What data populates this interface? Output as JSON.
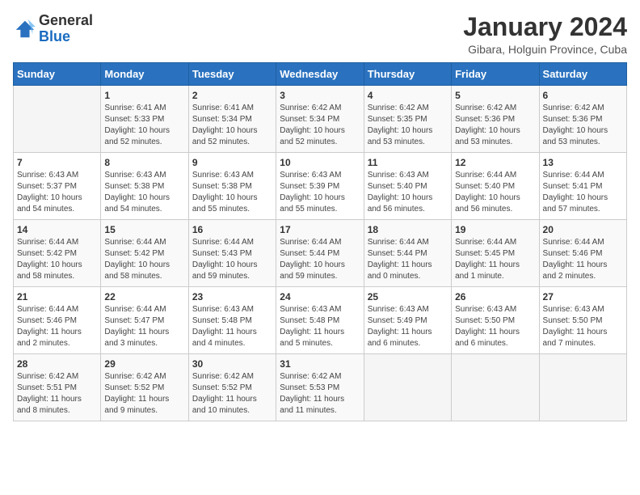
{
  "header": {
    "logo_line1": "General",
    "logo_line2": "Blue",
    "month_title": "January 2024",
    "subtitle": "Gibara, Holguin Province, Cuba"
  },
  "weekdays": [
    "Sunday",
    "Monday",
    "Tuesday",
    "Wednesday",
    "Thursday",
    "Friday",
    "Saturday"
  ],
  "weeks": [
    [
      {
        "day": "",
        "info": ""
      },
      {
        "day": "1",
        "info": "Sunrise: 6:41 AM\nSunset: 5:33 PM\nDaylight: 10 hours\nand 52 minutes."
      },
      {
        "day": "2",
        "info": "Sunrise: 6:41 AM\nSunset: 5:34 PM\nDaylight: 10 hours\nand 52 minutes."
      },
      {
        "day": "3",
        "info": "Sunrise: 6:42 AM\nSunset: 5:34 PM\nDaylight: 10 hours\nand 52 minutes."
      },
      {
        "day": "4",
        "info": "Sunrise: 6:42 AM\nSunset: 5:35 PM\nDaylight: 10 hours\nand 53 minutes."
      },
      {
        "day": "5",
        "info": "Sunrise: 6:42 AM\nSunset: 5:36 PM\nDaylight: 10 hours\nand 53 minutes."
      },
      {
        "day": "6",
        "info": "Sunrise: 6:42 AM\nSunset: 5:36 PM\nDaylight: 10 hours\nand 53 minutes."
      }
    ],
    [
      {
        "day": "7",
        "info": "Sunrise: 6:43 AM\nSunset: 5:37 PM\nDaylight: 10 hours\nand 54 minutes."
      },
      {
        "day": "8",
        "info": "Sunrise: 6:43 AM\nSunset: 5:38 PM\nDaylight: 10 hours\nand 54 minutes."
      },
      {
        "day": "9",
        "info": "Sunrise: 6:43 AM\nSunset: 5:38 PM\nDaylight: 10 hours\nand 55 minutes."
      },
      {
        "day": "10",
        "info": "Sunrise: 6:43 AM\nSunset: 5:39 PM\nDaylight: 10 hours\nand 55 minutes."
      },
      {
        "day": "11",
        "info": "Sunrise: 6:43 AM\nSunset: 5:40 PM\nDaylight: 10 hours\nand 56 minutes."
      },
      {
        "day": "12",
        "info": "Sunrise: 6:44 AM\nSunset: 5:40 PM\nDaylight: 10 hours\nand 56 minutes."
      },
      {
        "day": "13",
        "info": "Sunrise: 6:44 AM\nSunset: 5:41 PM\nDaylight: 10 hours\nand 57 minutes."
      }
    ],
    [
      {
        "day": "14",
        "info": "Sunrise: 6:44 AM\nSunset: 5:42 PM\nDaylight: 10 hours\nand 58 minutes."
      },
      {
        "day": "15",
        "info": "Sunrise: 6:44 AM\nSunset: 5:42 PM\nDaylight: 10 hours\nand 58 minutes."
      },
      {
        "day": "16",
        "info": "Sunrise: 6:44 AM\nSunset: 5:43 PM\nDaylight: 10 hours\nand 59 minutes."
      },
      {
        "day": "17",
        "info": "Sunrise: 6:44 AM\nSunset: 5:44 PM\nDaylight: 10 hours\nand 59 minutes."
      },
      {
        "day": "18",
        "info": "Sunrise: 6:44 AM\nSunset: 5:44 PM\nDaylight: 11 hours\nand 0 minutes."
      },
      {
        "day": "19",
        "info": "Sunrise: 6:44 AM\nSunset: 5:45 PM\nDaylight: 11 hours\nand 1 minute."
      },
      {
        "day": "20",
        "info": "Sunrise: 6:44 AM\nSunset: 5:46 PM\nDaylight: 11 hours\nand 2 minutes."
      }
    ],
    [
      {
        "day": "21",
        "info": "Sunrise: 6:44 AM\nSunset: 5:46 PM\nDaylight: 11 hours\nand 2 minutes."
      },
      {
        "day": "22",
        "info": "Sunrise: 6:44 AM\nSunset: 5:47 PM\nDaylight: 11 hours\nand 3 minutes."
      },
      {
        "day": "23",
        "info": "Sunrise: 6:43 AM\nSunset: 5:48 PM\nDaylight: 11 hours\nand 4 minutes."
      },
      {
        "day": "24",
        "info": "Sunrise: 6:43 AM\nSunset: 5:48 PM\nDaylight: 11 hours\nand 5 minutes."
      },
      {
        "day": "25",
        "info": "Sunrise: 6:43 AM\nSunset: 5:49 PM\nDaylight: 11 hours\nand 6 minutes."
      },
      {
        "day": "26",
        "info": "Sunrise: 6:43 AM\nSunset: 5:50 PM\nDaylight: 11 hours\nand 6 minutes."
      },
      {
        "day": "27",
        "info": "Sunrise: 6:43 AM\nSunset: 5:50 PM\nDaylight: 11 hours\nand 7 minutes."
      }
    ],
    [
      {
        "day": "28",
        "info": "Sunrise: 6:42 AM\nSunset: 5:51 PM\nDaylight: 11 hours\nand 8 minutes."
      },
      {
        "day": "29",
        "info": "Sunrise: 6:42 AM\nSunset: 5:52 PM\nDaylight: 11 hours\nand 9 minutes."
      },
      {
        "day": "30",
        "info": "Sunrise: 6:42 AM\nSunset: 5:52 PM\nDaylight: 11 hours\nand 10 minutes."
      },
      {
        "day": "31",
        "info": "Sunrise: 6:42 AM\nSunset: 5:53 PM\nDaylight: 11 hours\nand 11 minutes."
      },
      {
        "day": "",
        "info": ""
      },
      {
        "day": "",
        "info": ""
      },
      {
        "day": "",
        "info": ""
      }
    ]
  ]
}
